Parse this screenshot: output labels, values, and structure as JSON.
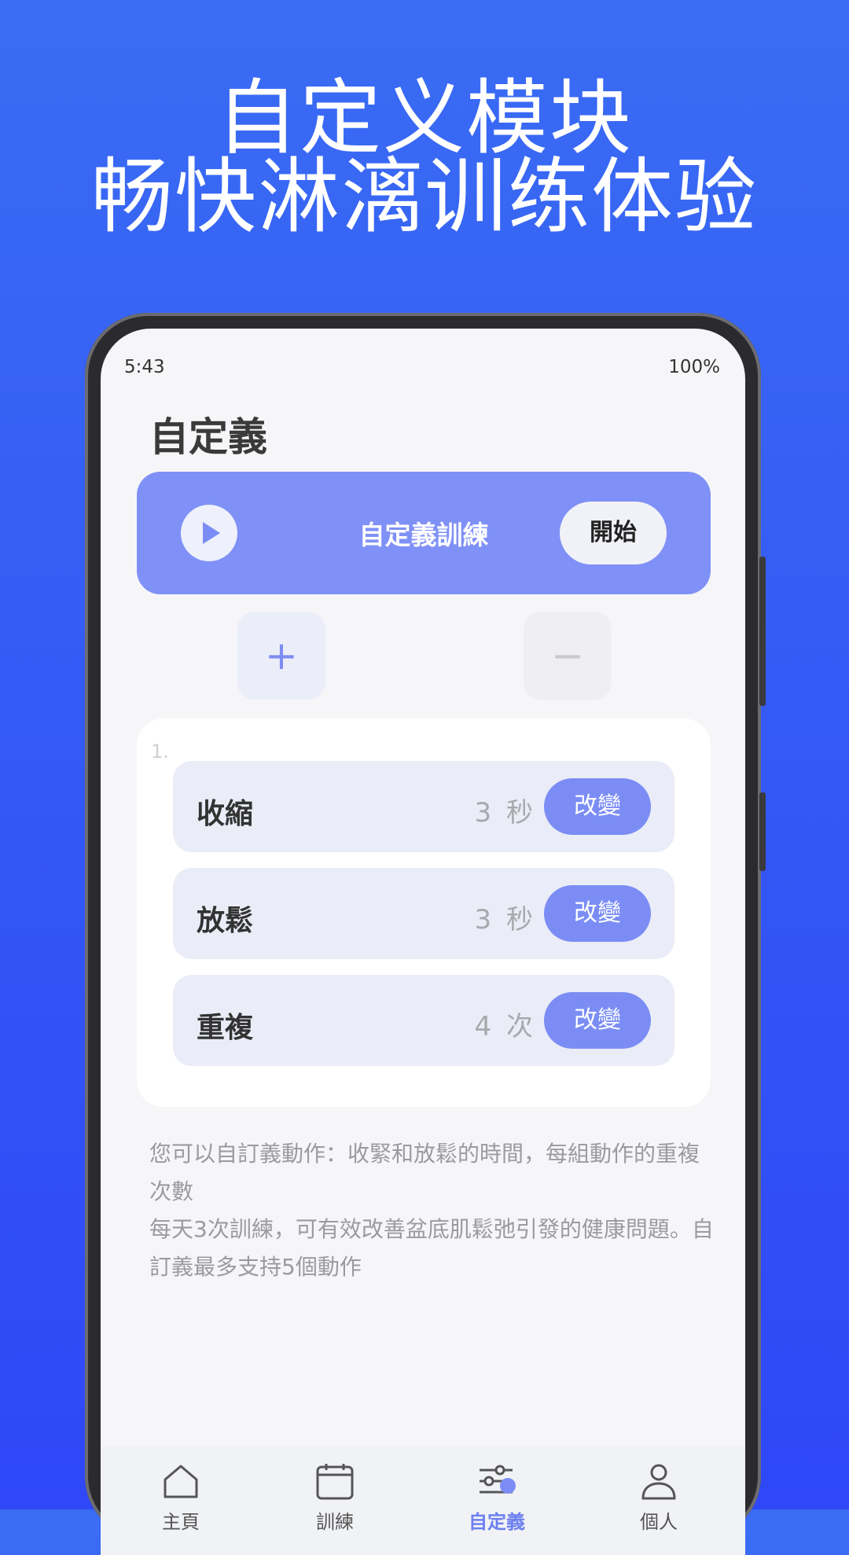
{
  "promo": {
    "line1": "自定义模块",
    "line2": "畅快淋漓训练体验"
  },
  "status_bar": {
    "time": "5:43",
    "battery": "100%"
  },
  "page": {
    "title": "自定義"
  },
  "hero": {
    "label": "自定義訓練",
    "start_label": "開始",
    "icon": "play-icon"
  },
  "controls": {
    "add_symbol": "+",
    "remove_symbol": "−"
  },
  "action_group": {
    "index": "1.",
    "rows": [
      {
        "label": "收縮",
        "value": "3 秒",
        "button": "改變"
      },
      {
        "label": "放鬆",
        "value": "3 秒",
        "button": "改變"
      },
      {
        "label": "重複",
        "value": "4 次",
        "button": "改變"
      }
    ]
  },
  "note": {
    "line1": "您可以自訂義動作：收緊和放鬆的時間，每組動作的重複次數",
    "line2": "每天3次訓練，可有效改善盆底肌鬆弛引發的健康問題。自訂義最多支持5個動作"
  },
  "tabbar": {
    "tabs": [
      {
        "label": "主頁",
        "icon": "home-icon"
      },
      {
        "label": "訓練",
        "icon": "calendar-icon"
      },
      {
        "label": "自定義",
        "icon": "sliders-icon",
        "active": true
      },
      {
        "label": "個人",
        "icon": "person-icon"
      }
    ],
    "accent": "#6d80f1"
  },
  "colors": {
    "background": "#3357f5",
    "hero": "#7f91f6",
    "change_button": "#7b8df5"
  }
}
